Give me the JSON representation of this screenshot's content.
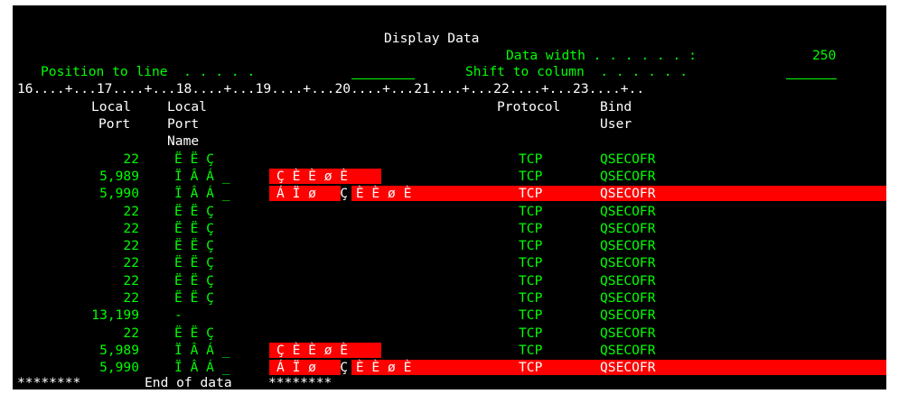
{
  "colors": {
    "background": "#000000",
    "text_white": "#ffffff",
    "text_green": "#00ff00",
    "highlight_red": "#ff0000"
  },
  "screen_title": "Display Data",
  "data_width": {
    "label": "Data width . . . . . . :",
    "value": "250"
  },
  "position_to_line": {
    "label": "Position to line  . . . . .",
    "value": ""
  },
  "shift_to_column": {
    "label": "Shift to column  . . . . . .",
    "value": ""
  },
  "ruler": "16....+...17....+...18....+...19....+...20....+...21....+...22....+...23....+..",
  "headers": {
    "local_port": [
      "Local",
      "Port"
    ],
    "local_port_name": [
      "Local",
      "Port",
      "Name"
    ],
    "protocol": "Protocol",
    "bind_user": [
      "Bind",
      "User"
    ]
  },
  "rows": [
    {
      "port": "22",
      "name": "Ë Ë Ç",
      "extra": "",
      "protocol": "TCP",
      "user": "QSECOFR",
      "highlight": "none"
    },
    {
      "port": "5,989",
      "name": "Ï Â Á _",
      "extra": "Ç È È ø È",
      "protocol": "TCP",
      "user": "QSECOFR",
      "highlight": "partial"
    },
    {
      "port": "5,990",
      "name": "Ï Â Á _",
      "extra": "Á Ï ø   Ç È È ø È",
      "protocol": "TCP",
      "user": "QSECOFR",
      "highlight": "full"
    },
    {
      "port": "22",
      "name": "Ë Ë Ç",
      "extra": "",
      "protocol": "TCP",
      "user": "QSECOFR",
      "highlight": "none"
    },
    {
      "port": "22",
      "name": "Ë Ë Ç",
      "extra": "",
      "protocol": "TCP",
      "user": "QSECOFR",
      "highlight": "none"
    },
    {
      "port": "22",
      "name": "Ë Ë Ç",
      "extra": "",
      "protocol": "TCP",
      "user": "QSECOFR",
      "highlight": "none"
    },
    {
      "port": "22",
      "name": "Ë Ë Ç",
      "extra": "",
      "protocol": "TCP",
      "user": "QSECOFR",
      "highlight": "none"
    },
    {
      "port": "22",
      "name": "Ë Ë Ç",
      "extra": "",
      "protocol": "TCP",
      "user": "QSECOFR",
      "highlight": "none"
    },
    {
      "port": "22",
      "name": "Ë Ë Ç",
      "extra": "",
      "protocol": "TCP",
      "user": "QSECOFR",
      "highlight": "none"
    },
    {
      "port": "13,199",
      "name": "-",
      "extra": "",
      "protocol": "TCP",
      "user": "QSECOFR",
      "highlight": "none"
    },
    {
      "port": "22",
      "name": "Ë Ë Ç",
      "extra": "",
      "protocol": "TCP",
      "user": "QSECOFR",
      "highlight": "none"
    },
    {
      "port": "5,989",
      "name": "Ï Â Á _",
      "extra": "Ç È È ø È",
      "protocol": "TCP",
      "user": "QSECOFR",
      "highlight": "partial"
    },
    {
      "port": "5,990",
      "name": "Ï Â Á _",
      "extra": "Á Ï ø   Ç È È ø È",
      "protocol": "TCP",
      "user": "QSECOFR",
      "highlight": "full"
    }
  ],
  "footer": {
    "stars_left": "********",
    "end_text": "End of data",
    "stars_right": "********"
  }
}
